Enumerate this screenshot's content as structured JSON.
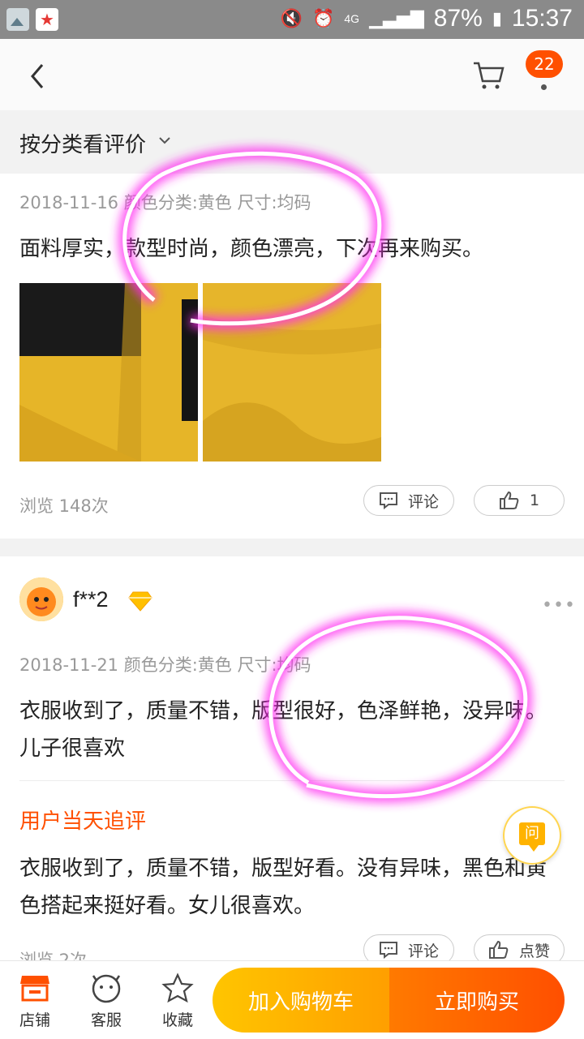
{
  "status_bar": {
    "battery": "87%",
    "time": "15:37",
    "network": "4G"
  },
  "nav": {
    "message_count": "22"
  },
  "filter": {
    "label": "按分类看评价"
  },
  "reviews": [
    {
      "meta": "2018-11-16 颜色分类:黄色 尺寸:均码",
      "content": "面料厚实，款型时尚，颜色漂亮，下次再来购买。",
      "views": "浏览 148次",
      "comment_label": "评论",
      "like_count": "1"
    },
    {
      "username": "f**2",
      "meta": "2018-11-21 颜色分类:黄色 尺寸:均码",
      "content": "衣服收到了，质量不错，版型很好，色泽鲜艳，没异味。儿子很喜欢",
      "followup_title": "用户当天追评",
      "followup_content": "衣服收到了，质量不错，版型好看。没有异味，黑色和黄色搭起来挺好看。女儿很喜欢。",
      "views": "浏览 2次",
      "comment_label": "评论",
      "like_label": "点赞"
    }
  ],
  "ask_fab": {
    "label": "问"
  },
  "bottom_bar": {
    "shop_label": "店铺",
    "service_label": "客服",
    "favorite_label": "收藏",
    "add_cart_label": "加入购物车",
    "buy_now_label": "立即购买"
  },
  "colors": {
    "accent": "#ff5000",
    "annotation": "#ff3cf0"
  }
}
